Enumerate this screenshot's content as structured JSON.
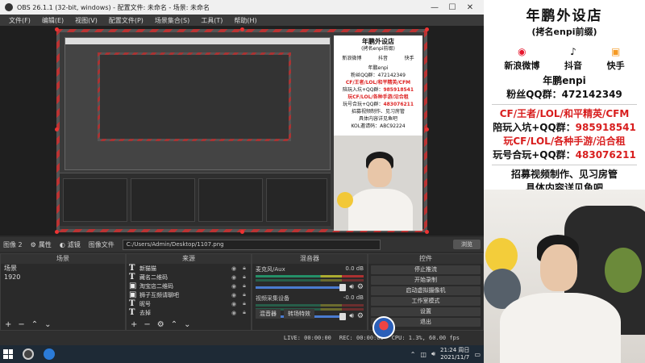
{
  "window": {
    "title": "OBS 26.1.1 (32-bit, windows) - 配置文件: 未命名 - 场景: 未命名",
    "minimize": "—",
    "maximize": "☐",
    "close": "✕"
  },
  "menu": [
    "文件(F)",
    "编辑(E)",
    "视图(V)",
    "配置文件(P)",
    "场景集合(S)",
    "工具(T)",
    "帮助(H)"
  ],
  "properties_bar": {
    "selected_label": "图像 2",
    "properties": "属性",
    "filters": "滤镜",
    "file_label": "图像文件",
    "path": "C:/Users/Admin/Desktop/1107.png",
    "browse": "浏览"
  },
  "scenes": {
    "header": "场景",
    "items": [
      "场景",
      "1920"
    ]
  },
  "sources": {
    "header": "来源",
    "items": [
      "新猫猫",
      "藏名二维码",
      "淘宝店二维码",
      "狮子互频请聊吧",
      "昵号",
      "去掉"
    ]
  },
  "mixer": {
    "header": "混音器",
    "channels": [
      {
        "name": "麦克风/Aux",
        "db": "0.0 dB"
      },
      {
        "name": "视频采集设备",
        "db": "-0.0 dB"
      }
    ],
    "tabs": [
      "混音器",
      "转场特效"
    ]
  },
  "controls": {
    "header": "控件",
    "buttons": [
      "停止推流",
      "开始录制",
      "启动虚拟摄像机",
      "工作室模式",
      "设置",
      "退出"
    ]
  },
  "statusbar": {
    "live": "LIVE: 00:00:00",
    "rec": "REC: 00:00:00",
    "cpu": "CPU: 1.3%, 60.00 fps"
  },
  "taskbar": {
    "time": "21:24 周日",
    "date": "2021/11/7"
  },
  "overlay": {
    "title": "年鹏外设店",
    "subtitle": "(拷名enpi前缀)",
    "socials": [
      {
        "label": "新浪微博",
        "icon": "weibo-icon"
      },
      {
        "label": "抖音",
        "icon": "douyin-icon"
      },
      {
        "label": "快手",
        "icon": "kuaishou-icon"
      }
    ],
    "handle": "年鹏enpi",
    "fans_label": "粉丝QQ群：",
    "fans_qq": "472142349",
    "line1": "CF/王者/LOL/和平精英/CFM",
    "line2_label": "陪玩入坑+QQ群：",
    "line2_qq": "985918541",
    "line3": "玩CF/LOL/各种手游/沿合租",
    "line4_label": "玩号合玩+QQ群：",
    "line4_qq": "483076211",
    "line5": "招募视频制作、见习房管",
    "line6": "具体内容详见鱼吧",
    "kol": "KOL邀请码：ABC92224"
  },
  "colors": {
    "accent_red": "#d81e1e",
    "obs_bg": "#2b2b2b",
    "volume_blue": "#4a7bd0"
  }
}
